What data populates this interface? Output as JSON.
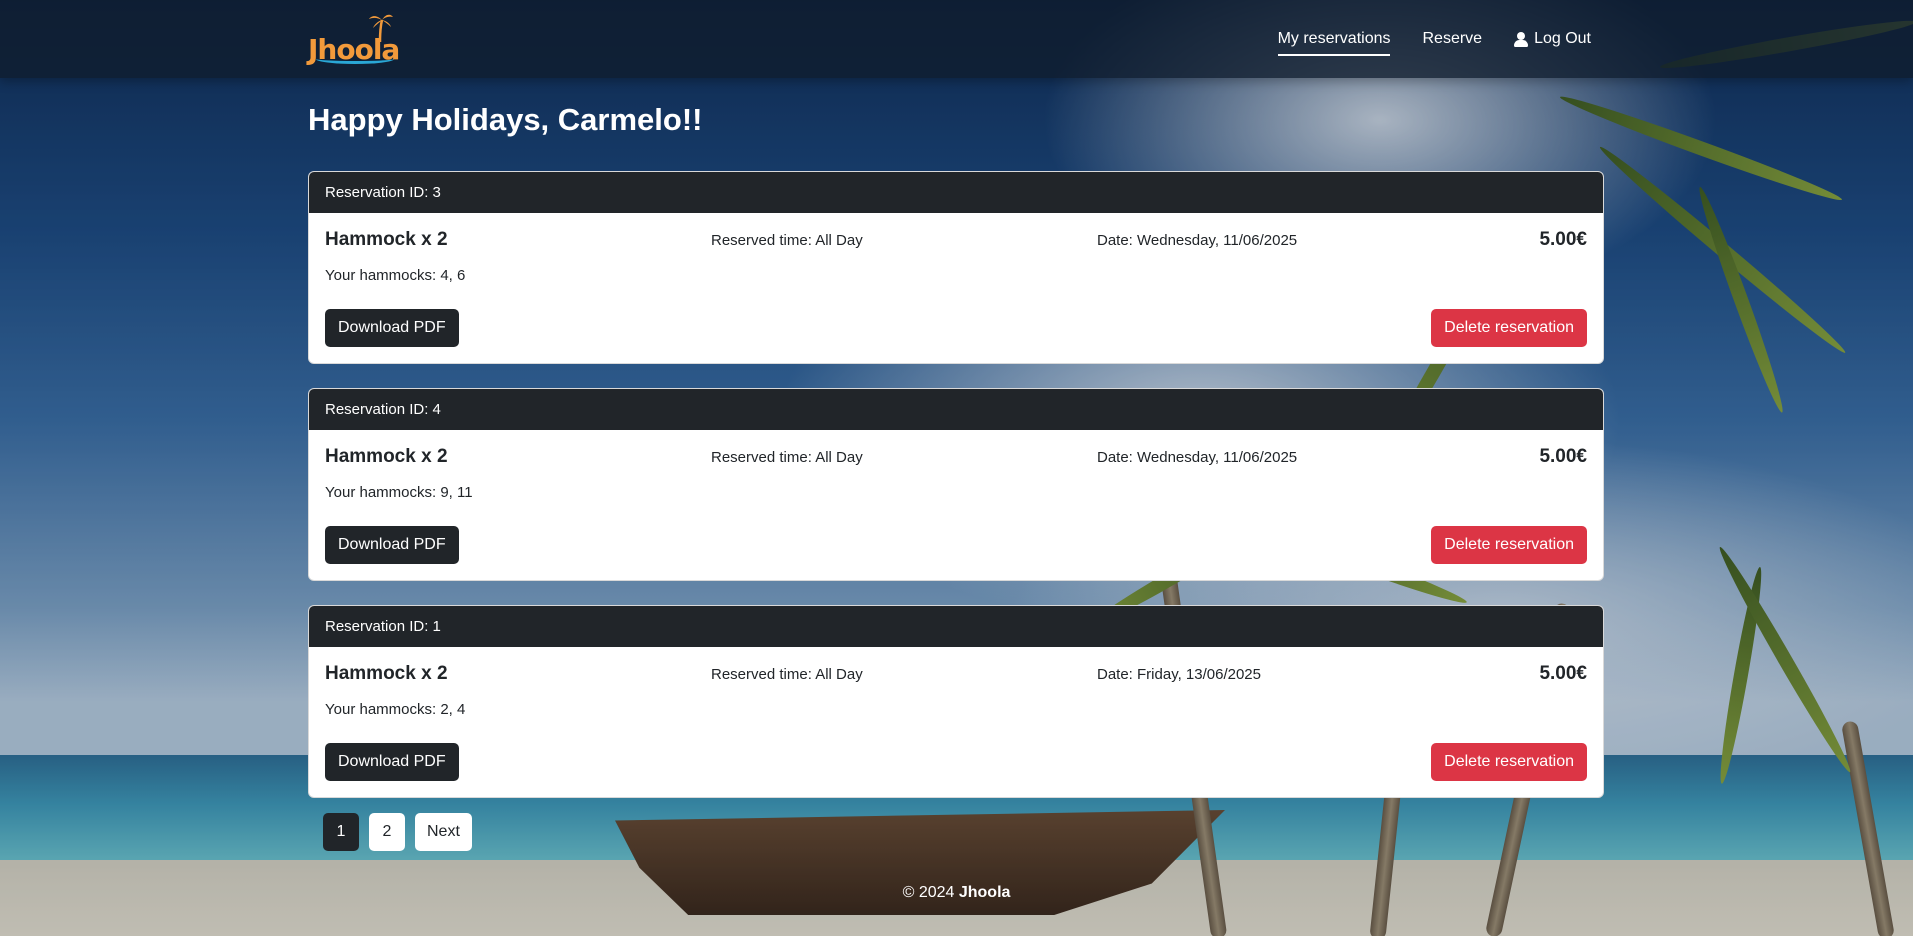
{
  "brand": {
    "name": "Jhoola"
  },
  "nav": {
    "items": [
      {
        "label": "My reservations",
        "active": true
      },
      {
        "label": "Reserve",
        "active": false
      },
      {
        "label": "Log Out",
        "active": false,
        "icon": "user-icon"
      }
    ]
  },
  "greeting": "Happy Holidays, Carmelo!!",
  "reservations": [
    {
      "header": "Reservation ID: 3",
      "title": "Hammock x 2",
      "time": "Reserved time: All Day",
      "date": "Date: Wednesday, 11/06/2025",
      "price": "5.00€",
      "hammocks": "Your hammocks: 4, 6",
      "download_label": "Download PDF",
      "delete_label": "Delete reservation"
    },
    {
      "header": "Reservation ID: 4",
      "title": "Hammock x 2",
      "time": "Reserved time: All Day",
      "date": "Date: Wednesday, 11/06/2025",
      "price": "5.00€",
      "hammocks": "Your hammocks: 9, 11",
      "download_label": "Download PDF",
      "delete_label": "Delete reservation"
    },
    {
      "header": "Reservation ID: 1",
      "title": "Hammock x 2",
      "time": "Reserved time: All Day",
      "date": "Date: Friday, 13/06/2025",
      "price": "5.00€",
      "hammocks": "Your hammocks: 2, 4",
      "download_label": "Download PDF",
      "delete_label": "Delete reservation"
    }
  ],
  "pagination": {
    "pages": [
      "1",
      "2"
    ],
    "current": "1",
    "next_label": "Next"
  },
  "footer": {
    "prefix": "© 2024",
    "brand": "Jhoola"
  },
  "colors": {
    "navbar": "#0f1c2d",
    "card_header": "#212529",
    "danger": "#dc3545",
    "brand_orange": "#f29a3b",
    "brand_blue": "#2aa7d6"
  }
}
